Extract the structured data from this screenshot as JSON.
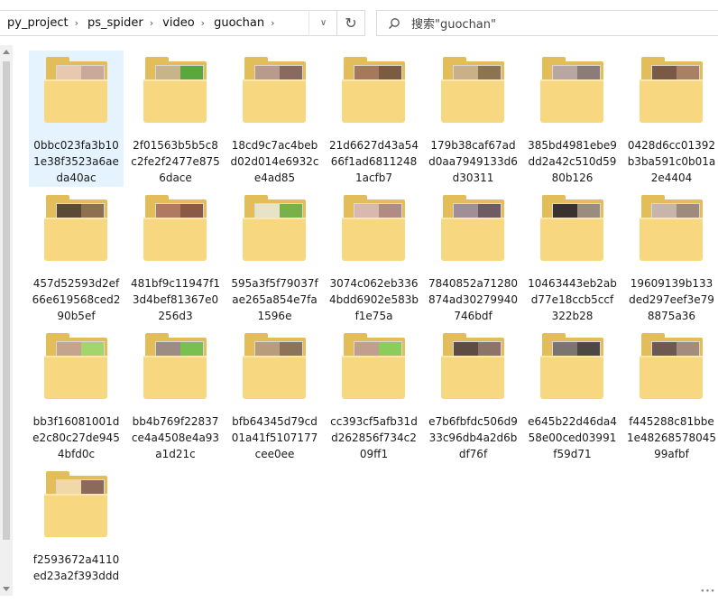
{
  "breadcrumb": [
    "py_project",
    "ps_spider",
    "video",
    "guochan"
  ],
  "search": {
    "placeholder": "搜索\"guochan\""
  },
  "files": [
    {
      "name": "0bbc023fa3b101e38f3523a6aeda40ac",
      "selected": true,
      "colors": [
        "#e8c9b0",
        "#caa99a",
        "#2b2b2b",
        "#7a6d6a",
        "#d9c2b5"
      ]
    },
    {
      "name": "2f01563b5b5c8c2fe2f2477e8756dace",
      "selected": false,
      "colors": [
        "#c8b48a",
        "#5aa73e",
        "#c4a38d",
        "#9a7b62",
        "#e6ddd2"
      ]
    },
    {
      "name": "18cd9c7ac4bebd02d014e6932ce4ad85",
      "selected": false,
      "colors": [
        "#b89b8c",
        "#8a6a5e",
        "#d6b8a6",
        "#6e5a52",
        "#c9a696"
      ]
    },
    {
      "name": "21d6627d43a5466f1ad68112481acfb7",
      "selected": false,
      "colors": [
        "#a57a5c",
        "#7d5a42",
        "#c99a7c",
        "#5e4333",
        "#b28466"
      ]
    },
    {
      "name": "179b38caf67add0aa7949133d6d30311",
      "selected": false,
      "colors": [
        "#c9b089",
        "#8c7352",
        "#e0cfa8",
        "#6d5740",
        "#b59b76"
      ]
    },
    {
      "name": "385bd4981ebe9dd2a42c510d5980b126",
      "selected": false,
      "colors": [
        "#b8a6a0",
        "#8c7c78",
        "#d9cbc6",
        "#a39089",
        "#c5b3ad"
      ]
    },
    {
      "name": "0428d6cc01392b3ba591c0b01a2e4404",
      "selected": false,
      "colors": [
        "#7a5a44",
        "#a88064",
        "#4e3828",
        "#c9a48a",
        "#8c6a52"
      ]
    },
    {
      "name": "457d52593d2ef66e619568ced290b5ef",
      "selected": false,
      "colors": [
        "#5c4a36",
        "#8c7050",
        "#3a2e22",
        "#a88c6c",
        "#6e583e"
      ]
    },
    {
      "name": "481bf9c11947f13d4bef81367e0256d3",
      "selected": false,
      "colors": [
        "#b07a62",
        "#8a5a46",
        "#d09c84",
        "#6e4434",
        "#c08a72"
      ]
    },
    {
      "name": "595a3f5f79037fae265a854e7fa1596e",
      "selected": false,
      "colors": [
        "#e8e2c8",
        "#7ab04a",
        "#2a2a2a",
        "#d8d0b0",
        "#c4c0a4"
      ]
    },
    {
      "name": "3074c062eb3364bdd6902e583bf1e75a",
      "selected": false,
      "colors": [
        "#d8b8b0",
        "#b08c84",
        "#e8d4cc",
        "#9a7068",
        "#c8a49c"
      ]
    },
    {
      "name": "7840852a71280874ad30279940746bdf",
      "selected": false,
      "colors": [
        "#a09096",
        "#6e5c62",
        "#c6b8bc",
        "#4a3e42",
        "#8c7c80"
      ]
    },
    {
      "name": "10463443eb2abd77e18ccb5ccf322b28",
      "selected": false,
      "colors": [
        "#3a322e",
        "#9c8c80",
        "#1e1a18",
        "#b8aca2",
        "#6c6058"
      ]
    },
    {
      "name": "19609139b133ded297eef3e798875a36",
      "selected": false,
      "colors": [
        "#c8b4aa",
        "#a08a80",
        "#e2d4cc",
        "#8a746a",
        "#b89e92"
      ]
    },
    {
      "name": "bb3f16081001de2c80c27de9454bfd0c",
      "selected": false,
      "colors": [
        "#c4a48c",
        "#a4d46c",
        "#d8c0b0",
        "#8c6c58",
        "#e0d0c4"
      ]
    },
    {
      "name": "bb4b769f22837ce4a4508e4a93a1d21c",
      "selected": false,
      "colors": [
        "#9c8c84",
        "#7ac050",
        "#b8aaa2",
        "#6e5e56",
        "#d0c4bc"
      ]
    },
    {
      "name": "bfb64345d79cd01a41f5107177cee0ee",
      "selected": false,
      "colors": [
        "#b89c7c",
        "#8c7458",
        "#d4bc9c",
        "#6a563e",
        "#e0d4c4"
      ]
    },
    {
      "name": "cc393cf5afb31dd262856f734c209ff1",
      "selected": false,
      "colors": [
        "#c0a08c",
        "#8ccc5c",
        "#d8bca8",
        "#a4846c",
        "#e8d8cc"
      ]
    },
    {
      "name": "e7b6fbfdc506d933c96db4a2d6bdf76f",
      "selected": false,
      "colors": [
        "#5c4c44",
        "#8c7468",
        "#3a302c",
        "#a48c7e",
        "#6e5a50"
      ]
    },
    {
      "name": "e645b22d46da458e00ced03991f59d71",
      "selected": false,
      "colors": [
        "#7c7470",
        "#4e4844",
        "#a49c98",
        "#383432",
        "#8c8480"
      ]
    },
    {
      "name": "f445288c81bbe1e48268578045 99afbf",
      "selected": false,
      "colors": [
        "#6c5a50",
        "#a48c7c",
        "#3e322c",
        "#c4aa98",
        "#8a7264"
      ]
    },
    {
      "name": "f2593672a4110ed23a2f393ddd",
      "selected": false,
      "colors": [
        "#f0d8a8",
        "#8c6a5a",
        "#c0a488",
        "#b49484",
        "#e8d4c0"
      ]
    }
  ]
}
